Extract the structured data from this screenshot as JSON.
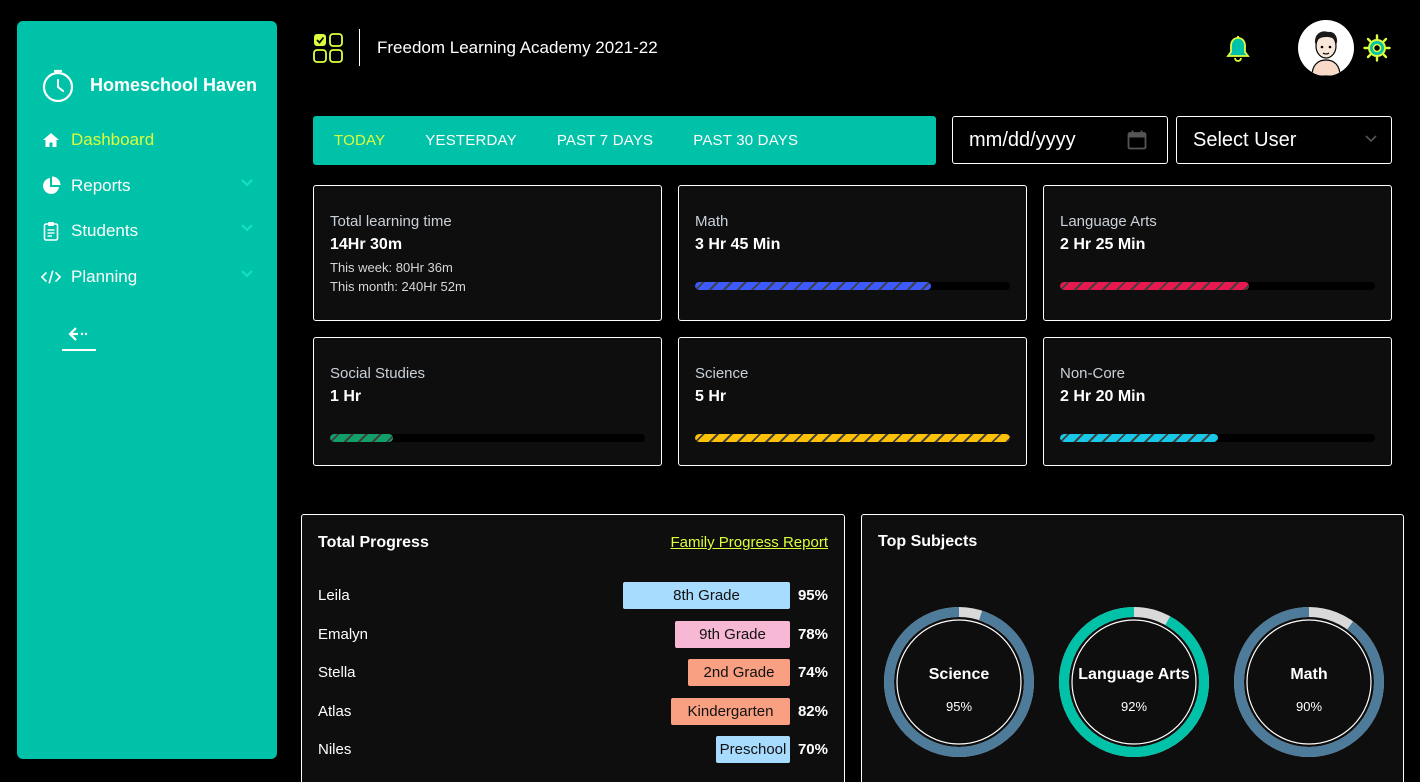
{
  "sidebar": {
    "brand": "Homeschool Haven",
    "items": [
      {
        "label": "Dashboard",
        "icon": "home-icon",
        "active": true
      },
      {
        "label": "Reports",
        "icon": "pie-chart-icon"
      },
      {
        "label": "Students",
        "icon": "clipboard-icon"
      },
      {
        "label": "Planning",
        "icon": "code-icon"
      }
    ],
    "collapse_icon": "collapse-arrow-icon"
  },
  "header": {
    "title": "Freedom Learning Academy 2021-22"
  },
  "filters": {
    "tabs": [
      "TODAY",
      "YESTERDAY",
      "PAST 7 DAYS",
      "PAST 30 DAYS"
    ],
    "active_tab": "TODAY",
    "date_placeholder": "mm/dd/yyyy",
    "select_user": "Select User"
  },
  "stats": {
    "total": {
      "title": "Total learning time",
      "value": "14Hr 30m",
      "week": "This week: 80Hr 36m",
      "month": "This month: 240Hr 52m"
    },
    "math": {
      "title": "Math",
      "value": "3 Hr 45 Min",
      "progress": 0.75,
      "color": "#3d5afe"
    },
    "language_arts": {
      "title": "Language Arts",
      "value": "2 Hr 25 Min",
      "progress": 0.6,
      "color": "#e8194e"
    },
    "social_studies": {
      "title": "Social Studies",
      "value": "1 Hr",
      "progress": 0.2,
      "color": "#12a06a"
    },
    "science": {
      "title": "Science",
      "value": "5 Hr",
      "progress": 1.0,
      "color": "#ffc107"
    },
    "non_core": {
      "title": "Non-Core",
      "value": "2 Hr 20 Min",
      "progress": 0.5,
      "color": "#18c8e8"
    }
  },
  "progress": {
    "title": "Total Progress",
    "link": "Family Progress Report",
    "rows": [
      {
        "name": "Leila",
        "grade": "8th Grade",
        "pct": "95%",
        "color": "#a8dcff"
      },
      {
        "name": "Emalyn",
        "grade": "9th Grade",
        "pct": "78%",
        "color": "#f7b8d6"
      },
      {
        "name": "Stella",
        "grade": "2nd Grade",
        "pct": "74%",
        "color": "#f99f82"
      },
      {
        "name": "Atlas",
        "grade": "Kindergarten",
        "pct": "82%",
        "color": "#f99f82"
      },
      {
        "name": "Niles",
        "grade": "Preschool",
        "pct": "70%",
        "color": "#a8dcff"
      }
    ]
  },
  "top_subjects": {
    "title": "Top Subjects",
    "items": [
      {
        "name": "Science",
        "pct": "95%",
        "value": 0.95,
        "color": "#4d7b99"
      },
      {
        "name": "Language Arts",
        "pct": "92%",
        "value": 0.92,
        "color": "#00c2a8"
      },
      {
        "name": "Math",
        "pct": "90%",
        "value": 0.9,
        "color": "#4d7b99"
      }
    ]
  }
}
